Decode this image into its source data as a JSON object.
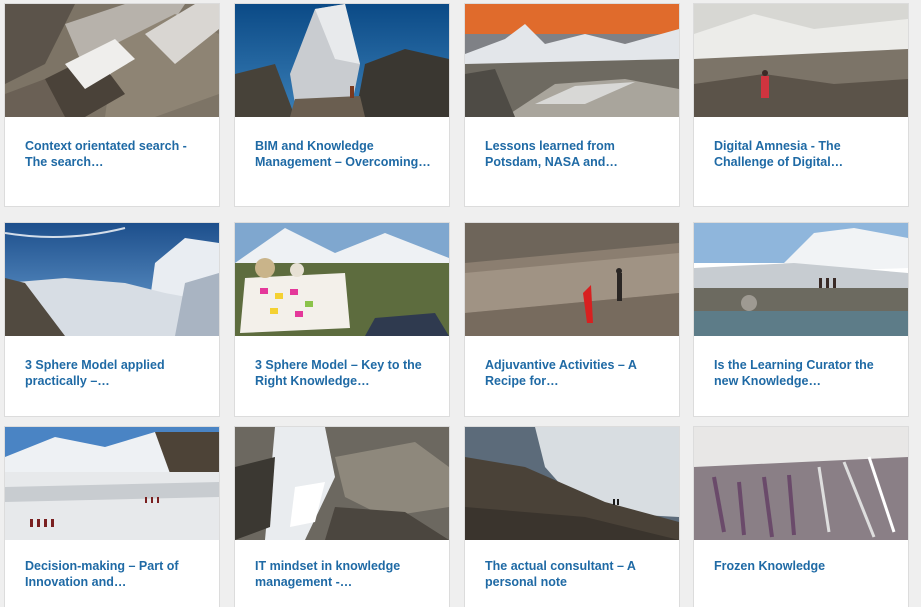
{
  "posts": [
    {
      "title": "Context orientated search - The search…",
      "image": "rocky-glacier-closeup"
    },
    {
      "title": "BIM and Knowledge Management – Overcoming…",
      "image": "mountain-hut"
    },
    {
      "title": "Lessons learned from Potsdam, NASA and…",
      "image": "glacier-valley-orange-sky"
    },
    {
      "title": "Digital Amnesia - The Challenge of Digital…",
      "image": "hiker-on-glacier"
    },
    {
      "title": "3 Sphere Model applied practically –…",
      "image": "blue-sky-glacier"
    },
    {
      "title": "3 Sphere Model – Key to the Right Knowledge…",
      "image": "sticky-notes-board-mountains"
    },
    {
      "title": "Adjuvantive Activities – A Recipe for…",
      "image": "hiker-rock-slope-red-flag"
    },
    {
      "title": "Is the Learning Curator the new Knowledge…",
      "image": "hikers-lake-mountains"
    },
    {
      "title": "Decision-making – Part of Innovation and…",
      "image": "rope-team-glacier"
    },
    {
      "title": "IT mindset in knowledge management -…",
      "image": "mountain-stream-rocks"
    },
    {
      "title": "The actual consultant – A personal note",
      "image": "hikers-ridge-glacier"
    },
    {
      "title": "Frozen Knowledge",
      "image": "ice-crystals"
    }
  ]
}
